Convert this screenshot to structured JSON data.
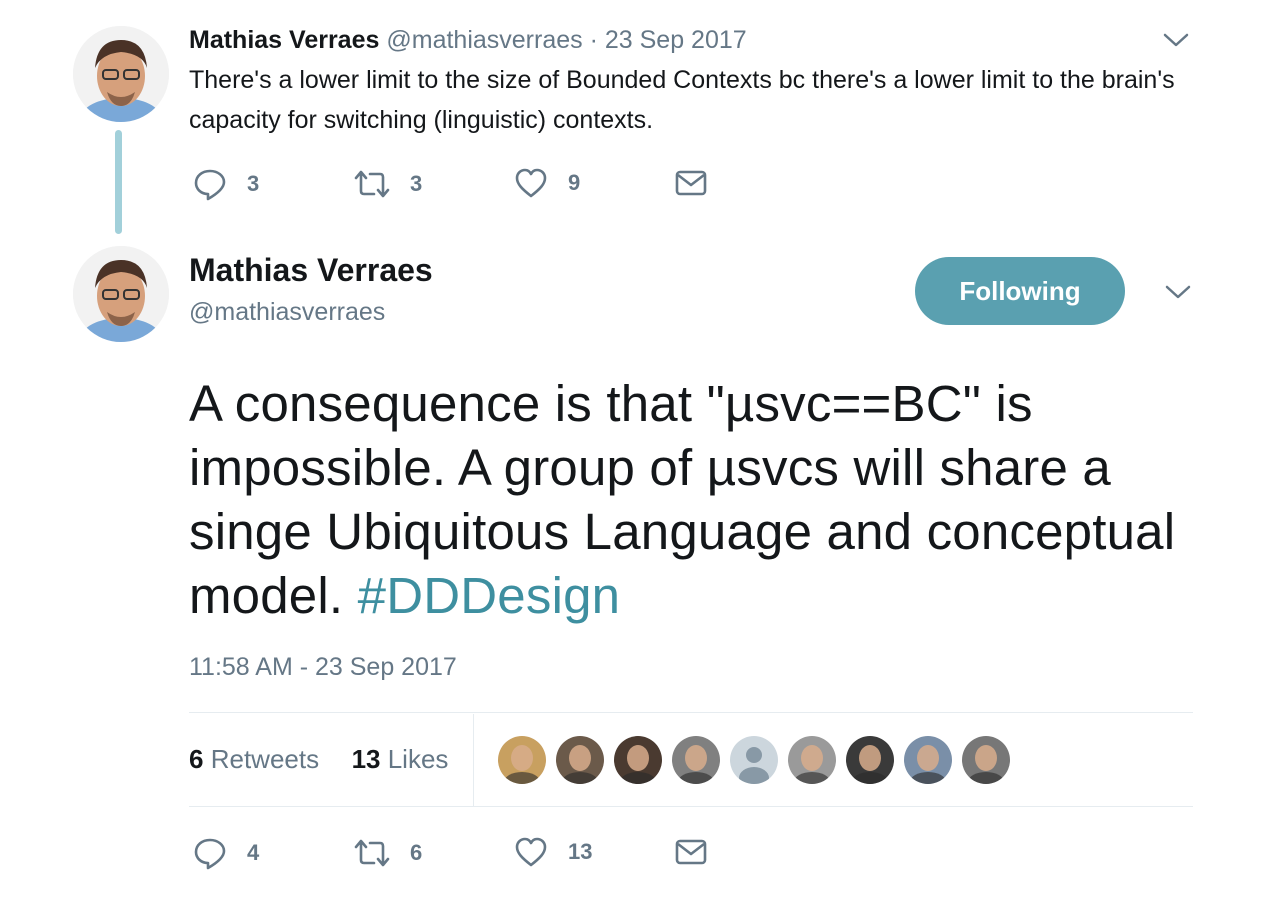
{
  "reply": {
    "author_name": "Mathias Verraes",
    "author_handle": "@mathiasverraes",
    "separator": "·",
    "date": "23 Sep 2017",
    "text": "There's a lower limit to the size of Bounded Contexts bc there's a lower limit to the brain's capacity for switching (linguistic) contexts.",
    "actions": {
      "replies": "3",
      "retweets": "3",
      "likes": "9"
    }
  },
  "tweet": {
    "author_name": "Mathias Verraes",
    "author_handle": "@mathiasverraes",
    "follow_label": "Following",
    "text": "A consequence is that \"µsvc==BC\" is impossible. A group of µsvcs will share a singe Ubiquitous Language and conceptual model. ",
    "hashtag": "#DDDesign",
    "timestamp": "11:58 AM - 23 Sep 2017",
    "stats": {
      "retweets_count": "6",
      "retweets_label": "Retweets",
      "likes_count": "13",
      "likes_label": "Likes"
    },
    "liker_avatars": [
      {
        "name": "liker-1",
        "color": "#c8a060"
      },
      {
        "name": "liker-2",
        "color": "#6b5a4a"
      },
      {
        "name": "liker-3",
        "color": "#4a3a30"
      },
      {
        "name": "liker-4",
        "color": "#808080"
      },
      {
        "name": "liker-default",
        "color": "#ccd6dd"
      },
      {
        "name": "liker-6",
        "color": "#9a9a9a"
      },
      {
        "name": "liker-7",
        "color": "#3a3a3a"
      },
      {
        "name": "liker-8",
        "color": "#7a8fa8"
      },
      {
        "name": "liker-9",
        "color": "#777777"
      }
    ],
    "actions": {
      "replies": "4",
      "retweets": "6",
      "likes": "13"
    }
  },
  "colors": {
    "accent": "#5aa0b0",
    "hashtag": "#3e8fa0",
    "thread_line": "#a2d0da",
    "muted": "#657786"
  }
}
